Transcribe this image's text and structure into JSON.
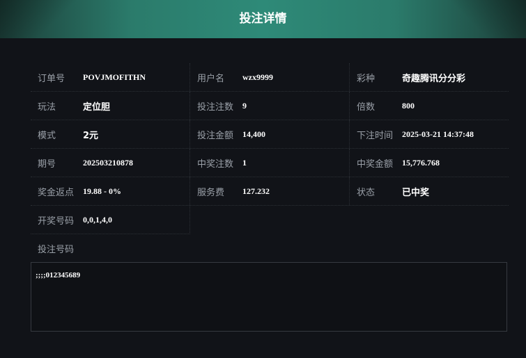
{
  "title": "投注详情",
  "rows": [
    [
      {
        "label": "订单号",
        "value": "POVJMOFITHN"
      },
      {
        "label": "用户名",
        "value": "wzx9999"
      },
      {
        "label": "彩种",
        "value": "奇趣腾讯分分彩"
      }
    ],
    [
      {
        "label": "玩法",
        "value": "定位胆"
      },
      {
        "label": "投注注数",
        "value": "9"
      },
      {
        "label": "倍数",
        "value": "800"
      }
    ],
    [
      {
        "label": "模式",
        "value": "2元"
      },
      {
        "label": "投注金额",
        "value": "14,400"
      },
      {
        "label": "下注时间",
        "value": "2025-03-21 14:37:48"
      }
    ],
    [
      {
        "label": "期号",
        "value": "202503210878"
      },
      {
        "label": "中奖注数",
        "value": "1"
      },
      {
        "label": "中奖金额",
        "value": "15,776.768"
      }
    ],
    [
      {
        "label": "奖金返点",
        "value": "19.88 - 0%"
      },
      {
        "label": "服务费",
        "value": "127.232"
      },
      {
        "label": "状态",
        "value": "已中奖"
      }
    ],
    [
      {
        "label": "开奖号码",
        "value": "0,0,1,4,0"
      }
    ]
  ],
  "bet_numbers": {
    "label": "投注号码",
    "value": ";;;;012345689"
  }
}
